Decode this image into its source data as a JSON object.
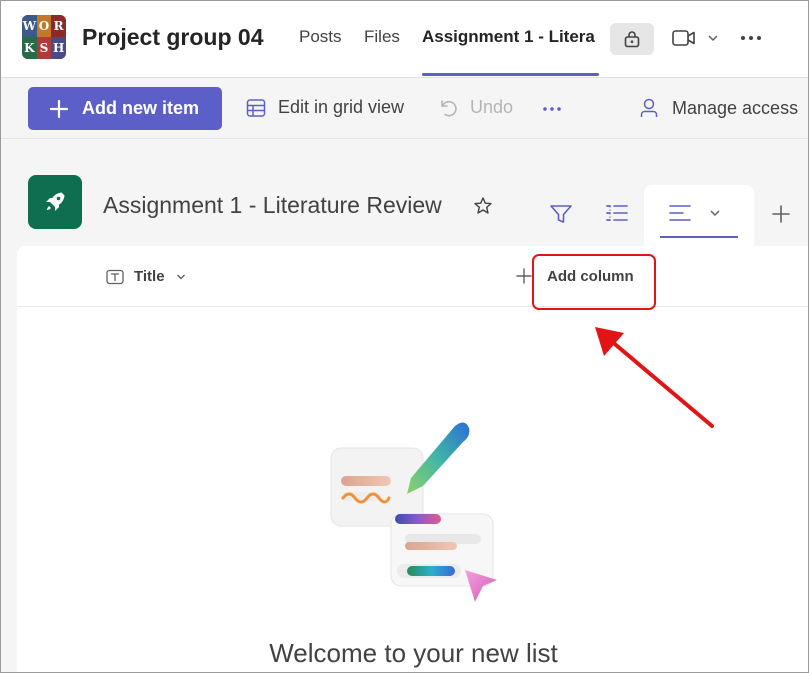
{
  "team": {
    "name": "Project group 04",
    "avatar_letters": [
      "W",
      "O",
      "R",
      "K",
      "S",
      "H"
    ]
  },
  "tabs": {
    "posts": "Posts",
    "files": "Files",
    "active": "Assignment 1 - Litera"
  },
  "header_icons": [
    "lock-icon",
    "video-icon",
    "chevron-down-icon",
    "more-icon"
  ],
  "commands": {
    "add_new_item": "Add new item",
    "edit_grid": "Edit in grid view",
    "undo": "Undo",
    "manage_access": "Manage access"
  },
  "list": {
    "title": "Assignment 1 - Literature Review",
    "icon": "rocket-icon"
  },
  "columns": {
    "title": "Title",
    "add_column": "Add column"
  },
  "empty_state": {
    "heading": "Welcome to your new list"
  },
  "colors": {
    "accent": "#5b5fc7",
    "list_icon_bg": "#0f6e50",
    "annotation": "#e01515"
  }
}
